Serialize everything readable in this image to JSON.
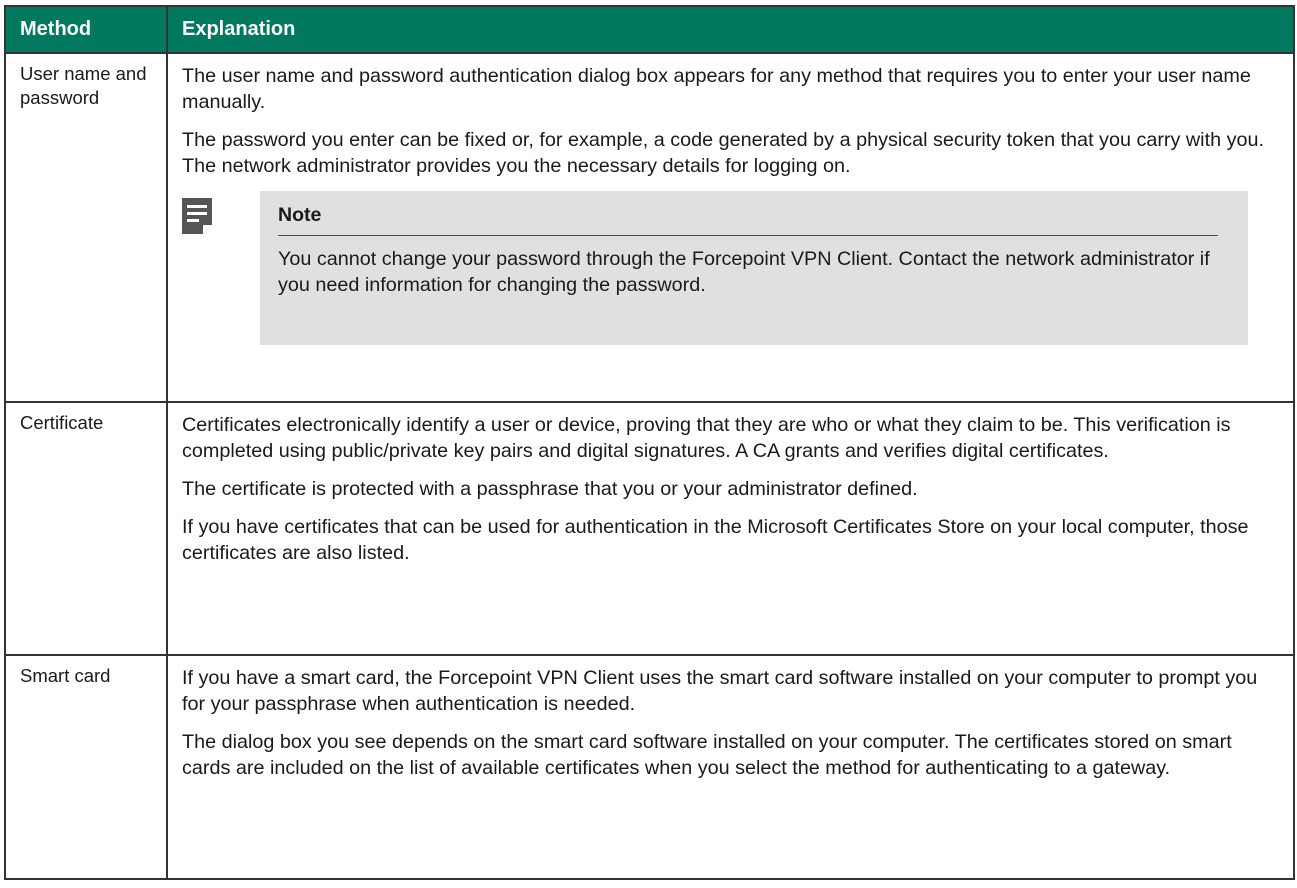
{
  "table": {
    "headers": {
      "method": "Method",
      "explanation": "Explanation"
    },
    "rows": [
      {
        "method": "User name and password",
        "paragraphs": [
          "The user name and password authentication dialog box appears for any method that requires you to enter your user name manually.",
          "The password you enter can be fixed or, for example, a code generated by a physical security token that you carry with you. The network administrator provides you the necessary details for logging on."
        ],
        "note": {
          "icon": "note-icon",
          "title": "Note",
          "text": "You cannot change your password through the Forcepoint VPN Client. Contact the network administrator if you need information for changing the password."
        }
      },
      {
        "method": "Certificate",
        "paragraphs": [
          "Certificates electronically identify a user or device, proving that they are who or what they claim to be. This verification is completed using public/private key pairs and digital signatures. A CA grants and verifies digital certificates.",
          "The certificate is protected with a passphrase that you or your administrator defined.",
          "If you have certificates that can be used for authentication in the Microsoft Certificates Store on your local computer, those certificates are also listed."
        ]
      },
      {
        "method": "Smart card",
        "paragraphs": [
          "If you have a smart card, the Forcepoint VPN Client uses the smart card software installed on your computer to prompt you for your passphrase when authentication is needed.",
          "The dialog box you see depends on the smart card software installed on your computer. The certificates stored on smart cards are included on the list of available certificates when you select the method for authenticating to a gateway."
        ]
      }
    ]
  },
  "colors": {
    "header_bg": "#00795f",
    "header_text": "#ffffff",
    "note_bg": "#e0e0e0",
    "border": "#333333"
  }
}
